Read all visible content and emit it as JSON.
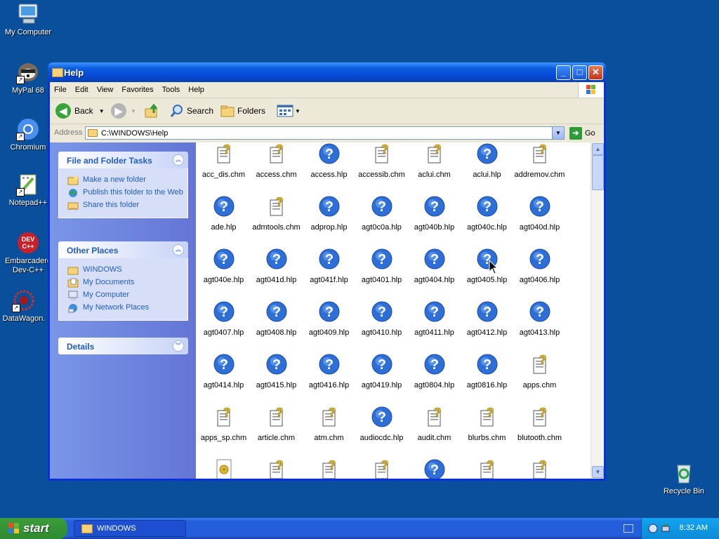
{
  "desktop": {
    "icons": [
      {
        "label": "My Computer"
      },
      {
        "label": "MyPal 68"
      },
      {
        "label": "Chromium"
      },
      {
        "label": "Notepad++"
      },
      {
        "label": "Embarcadero Dev-C++"
      },
      {
        "label": "DataWagon."
      },
      {
        "label": "Recycle Bin"
      }
    ]
  },
  "window": {
    "title": "Help",
    "menu": [
      "File",
      "Edit",
      "View",
      "Favorites",
      "Tools",
      "Help"
    ],
    "toolbar": {
      "back": "Back",
      "search": "Search",
      "folders": "Folders"
    },
    "address": {
      "label": "Address",
      "path": "C:\\WINDOWS\\Help",
      "go": "Go"
    }
  },
  "taskpane": {
    "file_folder_tasks": {
      "title": "File and Folder Tasks",
      "items": [
        "Make a new folder",
        "Publish this folder to the Web",
        "Share this folder"
      ]
    },
    "other_places": {
      "title": "Other Places",
      "items": [
        "WINDOWS",
        "My Documents",
        "My Computer",
        "My Network Places"
      ]
    },
    "details": {
      "title": "Details"
    }
  },
  "files": [
    {
      "name": "acc_dis.chm",
      "type": "chm"
    },
    {
      "name": "access.chm",
      "type": "chm"
    },
    {
      "name": "access.hlp",
      "type": "hlp"
    },
    {
      "name": "accessib.chm",
      "type": "chm"
    },
    {
      "name": "aclui.chm",
      "type": "chm"
    },
    {
      "name": "aclui.hlp",
      "type": "hlp"
    },
    {
      "name": "addremov.chm",
      "type": "chm"
    },
    {
      "name": "ade.hlp",
      "type": "hlp"
    },
    {
      "name": "admtools.chm",
      "type": "chm"
    },
    {
      "name": "adprop.hlp",
      "type": "hlp"
    },
    {
      "name": "agt0c0a.hlp",
      "type": "hlp"
    },
    {
      "name": "agt040b.hlp",
      "type": "hlp"
    },
    {
      "name": "agt040c.hlp",
      "type": "hlp"
    },
    {
      "name": "agt040d.hlp",
      "type": "hlp"
    },
    {
      "name": "agt040e.hlp",
      "type": "hlp"
    },
    {
      "name": "agt041d.hlp",
      "type": "hlp"
    },
    {
      "name": "agt041f.hlp",
      "type": "hlp"
    },
    {
      "name": "agt0401.hlp",
      "type": "hlp"
    },
    {
      "name": "agt0404.hlp",
      "type": "hlp"
    },
    {
      "name": "agt0405.hlp",
      "type": "hlp"
    },
    {
      "name": "agt0406.hlp",
      "type": "hlp"
    },
    {
      "name": "agt0407.hlp",
      "type": "hlp"
    },
    {
      "name": "agt0408.hlp",
      "type": "hlp"
    },
    {
      "name": "agt0409.hlp",
      "type": "hlp"
    },
    {
      "name": "agt0410.hlp",
      "type": "hlp"
    },
    {
      "name": "agt0411.hlp",
      "type": "hlp"
    },
    {
      "name": "agt0412.hlp",
      "type": "hlp"
    },
    {
      "name": "agt0413.hlp",
      "type": "hlp"
    },
    {
      "name": "agt0414.hlp",
      "type": "hlp"
    },
    {
      "name": "agt0415.hlp",
      "type": "hlp"
    },
    {
      "name": "agt0416.hlp",
      "type": "hlp"
    },
    {
      "name": "agt0419.hlp",
      "type": "hlp"
    },
    {
      "name": "agt0804.hlp",
      "type": "hlp"
    },
    {
      "name": "agt0816.hlp",
      "type": "hlp"
    },
    {
      "name": "apps.chm",
      "type": "chm"
    },
    {
      "name": "apps_sp.chm",
      "type": "chm"
    },
    {
      "name": "article.chm",
      "type": "chm"
    },
    {
      "name": "atm.chm",
      "type": "chm"
    },
    {
      "name": "audiocdc.hlp",
      "type": "hlp"
    },
    {
      "name": "audit.chm",
      "type": "chm"
    },
    {
      "name": "blurbs.chm",
      "type": "chm"
    },
    {
      "name": "blutooth.chm",
      "type": "chm"
    },
    {
      "name": "",
      "type": "gear"
    },
    {
      "name": "",
      "type": "chm"
    },
    {
      "name": "",
      "type": "chm"
    },
    {
      "name": "",
      "type": "chm"
    },
    {
      "name": "",
      "type": "hlp"
    },
    {
      "name": "",
      "type": "chm"
    },
    {
      "name": "",
      "type": "chm"
    }
  ],
  "taskbar": {
    "start": "start",
    "items": [
      {
        "label": "WINDOWS"
      }
    ],
    "clock": "8:32 AM"
  }
}
